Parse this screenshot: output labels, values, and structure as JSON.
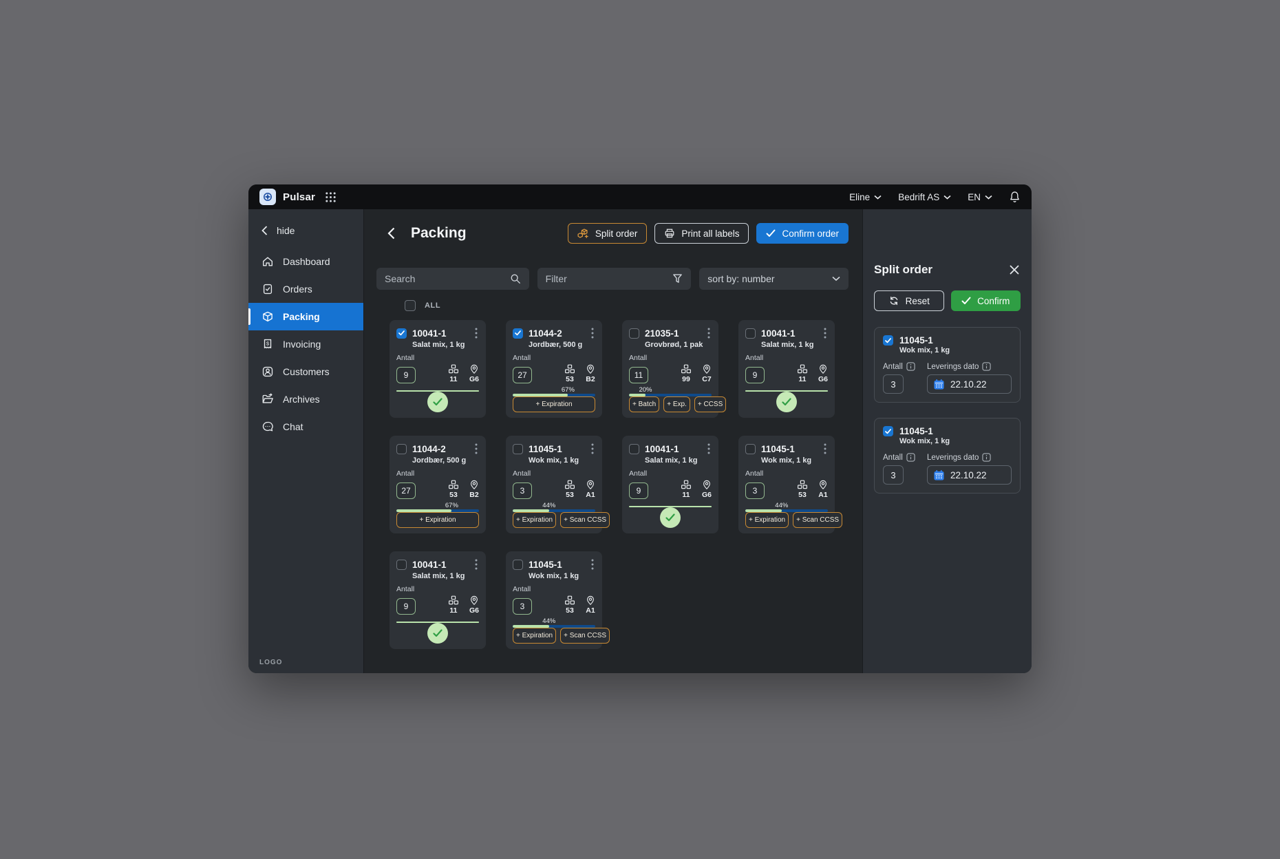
{
  "topbar": {
    "app_name": "Pulsar",
    "user_menu": "Eline",
    "company_menu": "Bedrift AS",
    "language_menu": "EN"
  },
  "sidebar": {
    "collapse_label": "hide",
    "items": [
      {
        "label": "Dashboard",
        "icon": "home-icon",
        "active": false
      },
      {
        "label": "Orders",
        "icon": "orders-icon",
        "active": false
      },
      {
        "label": "Packing",
        "icon": "packing-icon",
        "active": true
      },
      {
        "label": "Invoicing",
        "icon": "invoice-icon",
        "active": false
      },
      {
        "label": "Customers",
        "icon": "customers-icon",
        "active": false
      },
      {
        "label": "Archives",
        "icon": "archives-icon",
        "active": false
      },
      {
        "label": "Chat",
        "icon": "chat-icon",
        "active": false
      }
    ],
    "logo_text": "LOGO"
  },
  "header": {
    "title": "Packing",
    "split_order": "Split order",
    "print_all_labels": "Print all labels",
    "confirm_order": "Confirm order"
  },
  "controls": {
    "search_placeholder": "Search",
    "filter_placeholder": "Filter",
    "sort_value": "sort by: number",
    "select_all": "ALL"
  },
  "labels": {
    "antall": "Antall",
    "leverings_dato": "Leverings dato"
  },
  "cards": [
    {
      "id": "10041-1",
      "subtitle": "Salat mix, 1 kg",
      "checked": true,
      "antall": "9",
      "units": "11",
      "location": "G6",
      "progress": 100,
      "progress_label": "",
      "done": true,
      "buttons": []
    },
    {
      "id": "11044-2",
      "subtitle": "Jordbær, 500 g",
      "checked": true,
      "antall": "27",
      "units": "53",
      "location": "B2",
      "progress": 67,
      "progress_label": "67%",
      "done": false,
      "buttons": [
        "+ Expiration"
      ]
    },
    {
      "id": "21035-1",
      "subtitle": "Grovbrød, 1 pak",
      "checked": false,
      "antall": "11",
      "units": "99",
      "location": "C7",
      "progress": 20,
      "progress_label": "20%",
      "done": false,
      "buttons": [
        "+ Batch",
        "+ Exp.",
        "+ CCSS"
      ]
    },
    {
      "id": "10041-1",
      "subtitle": "Salat mix, 1 kg",
      "checked": false,
      "antall": "9",
      "units": "11",
      "location": "G6",
      "progress": 100,
      "progress_label": "",
      "done": true,
      "buttons": []
    },
    {
      "id": "11044-2",
      "subtitle": "Jordbær, 500 g",
      "checked": false,
      "antall": "27",
      "units": "53",
      "location": "B2",
      "progress": 67,
      "progress_label": "67%",
      "done": false,
      "buttons": [
        "+ Expiration"
      ]
    },
    {
      "id": "11045-1",
      "subtitle": "Wok mix, 1 kg",
      "checked": false,
      "antall": "3",
      "units": "53",
      "location": "A1",
      "progress": 44,
      "progress_label": "44%",
      "done": false,
      "buttons": [
        "+ Expiration",
        "+ Scan CCSS"
      ]
    },
    {
      "id": "10041-1",
      "subtitle": "Salat mix, 1 kg",
      "checked": false,
      "antall": "9",
      "units": "11",
      "location": "G6",
      "progress": 100,
      "progress_label": "",
      "done": true,
      "buttons": []
    },
    {
      "id": "11045-1",
      "subtitle": "Wok mix, 1 kg",
      "checked": false,
      "antall": "3",
      "units": "53",
      "location": "A1",
      "progress": 44,
      "progress_label": "44%",
      "done": false,
      "buttons": [
        "+ Expiration",
        "+ Scan CCSS"
      ]
    },
    {
      "id": "10041-1",
      "subtitle": "Salat mix, 1 kg",
      "checked": false,
      "antall": "9",
      "units": "11",
      "location": "G6",
      "progress": 100,
      "progress_label": "",
      "done": true,
      "buttons": []
    },
    {
      "id": "11045-1",
      "subtitle": "Wok mix, 1 kg",
      "checked": false,
      "antall": "3",
      "units": "53",
      "location": "A1",
      "progress": 44,
      "progress_label": "44%",
      "done": false,
      "buttons": [
        "+ Expiration",
        "+ Scan CCSS"
      ]
    }
  ],
  "split_panel": {
    "title": "Split order",
    "reset": "Reset",
    "confirm": "Confirm",
    "items": [
      {
        "id": "11045-1",
        "subtitle": "Wok mix, 1 kg",
        "checked": true,
        "antall": "3",
        "date": "22.10.22"
      },
      {
        "id": "11045-1",
        "subtitle": "Wok mix, 1 kg",
        "checked": true,
        "antall": "3",
        "date": "22.10.22"
      }
    ]
  },
  "colors": {
    "accent_blue": "#1976d2",
    "confirm_green": "#2f9e44",
    "warning_orange": "#c98a33",
    "progress_green": "#b9e3ab",
    "progress_blue": "#0f4a8a"
  }
}
